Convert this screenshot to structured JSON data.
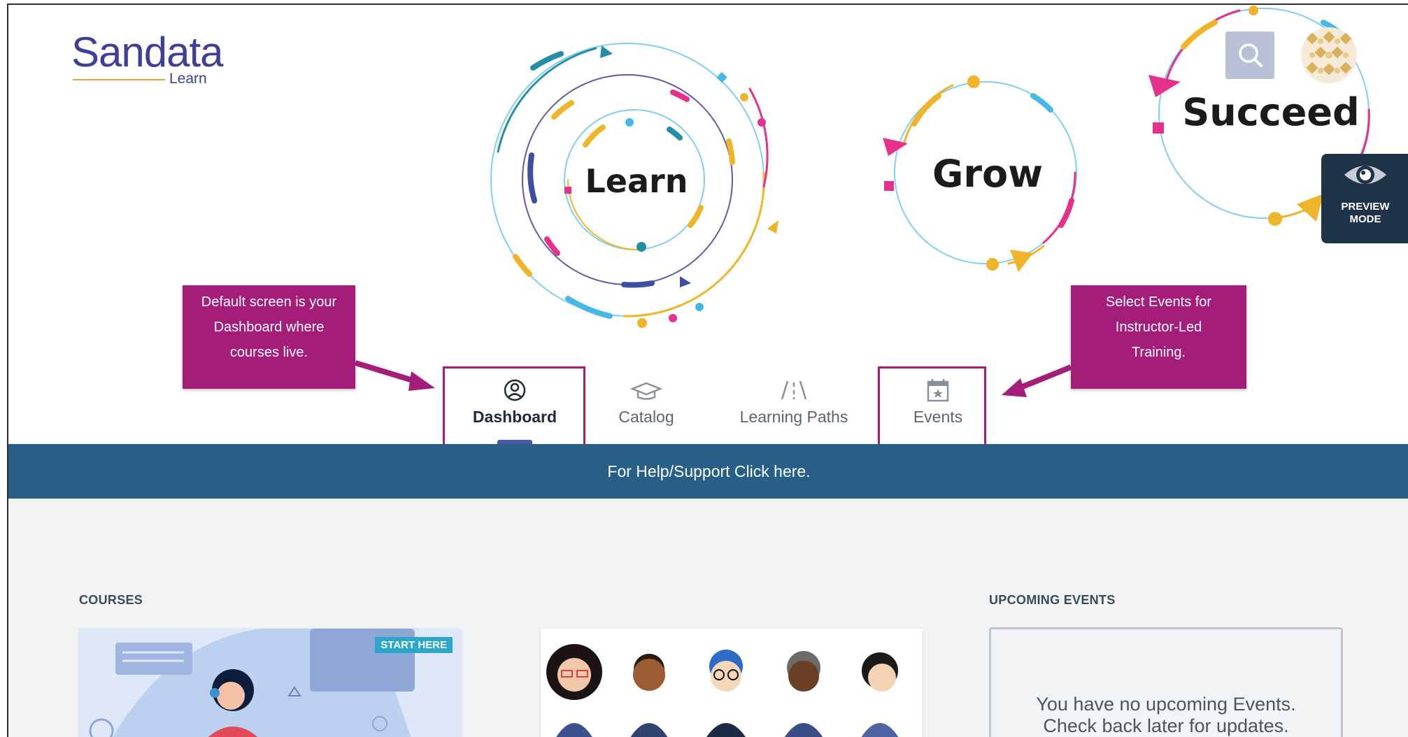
{
  "logo": {
    "brand": "Sandata",
    "sub": "Learn"
  },
  "hero": {
    "word_learn": "Learn",
    "word_grow": "Grow",
    "word_succeed": "Succeed"
  },
  "header": {
    "search_icon": "search-icon",
    "preview_label_1": "PREVIEW",
    "preview_label_2": "MODE"
  },
  "callouts": {
    "left": [
      "Default screen is your",
      "Dashboard where",
      "courses live."
    ],
    "right": [
      "Select Events for",
      "Instructor-Led",
      "Training."
    ]
  },
  "nav": {
    "tabs": [
      {
        "label": "Dashboard",
        "icon": "user-circle-icon",
        "active": true
      },
      {
        "label": "Catalog",
        "icon": "graduation-cap-icon",
        "active": false
      },
      {
        "label": "Learning Paths",
        "icon": "road-icon",
        "active": false
      },
      {
        "label": "Events",
        "icon": "calendar-star-icon",
        "active": false
      }
    ]
  },
  "help_bar": {
    "text": "For Help/Support Click here."
  },
  "courses": {
    "title": "COURSES",
    "badge": "START HERE"
  },
  "events": {
    "title": "UPCOMING EVENTS",
    "empty_line1": "You have no upcoming Events.",
    "empty_line2": "Check back later for updates."
  },
  "colors": {
    "accent": "#a41e79",
    "help_bar": "#275f87",
    "preview": "#1f3348",
    "active_underline": "#4a59a5"
  }
}
